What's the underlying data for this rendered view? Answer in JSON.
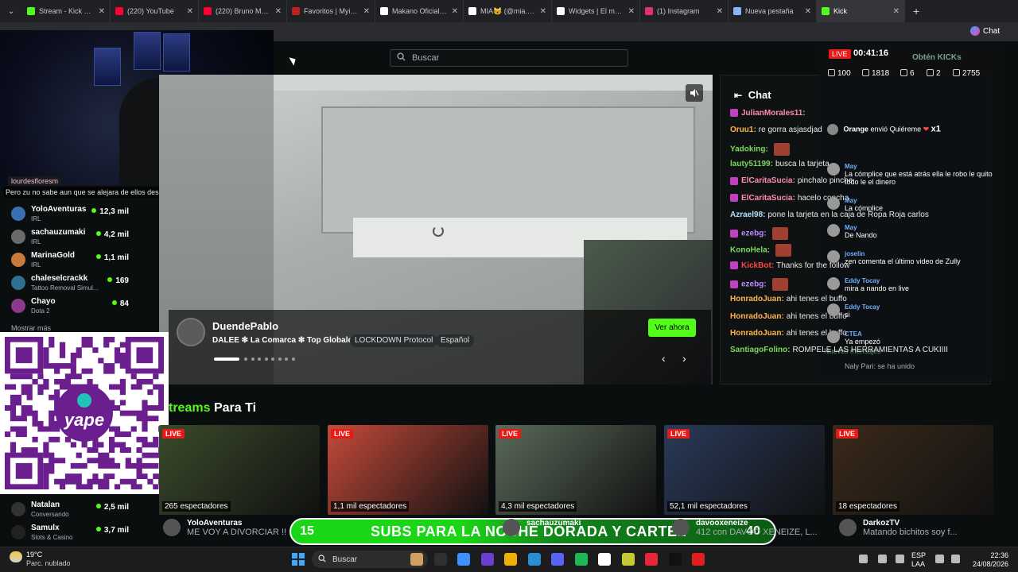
{
  "browser": {
    "tabs": [
      {
        "title": "Stream - Kick Dashb",
        "color": "#53fc18"
      },
      {
        "title": "(220) YouTube",
        "color": "#ff0033"
      },
      {
        "title": "(220) Bruno Mars - ",
        "color": "#ff0033"
      },
      {
        "title": "Favoritos | Myinstan",
        "color": "#c0201e"
      },
      {
        "title": "Makano Oficial (@m",
        "color": "#ffffff"
      },
      {
        "title": "MIA😺 (@mia.3s) | T",
        "color": "#ffffff"
      },
      {
        "title": "Widgets | El mejor s",
        "color": "#ffffff"
      },
      {
        "title": "(1) Instagram",
        "color": "#e1306c"
      },
      {
        "title": "Nueva pestaña",
        "color": "#8ab4f8"
      },
      {
        "title": "Kick",
        "color": "#53fc18"
      }
    ],
    "chat_button": "Chat"
  },
  "header": {
    "search_placeholder": "Buscar"
  },
  "webcam_overlay": {
    "username": "lourdesfloresm",
    "message": "Pero zu no sabe aun que se alejara de ellos después de esto"
  },
  "sidebar": {
    "channels": [
      {
        "name": "YoloAventuras",
        "category": "IRL",
        "viewers": "12,3 mil",
        "avatar_color": "#3a6fb0"
      },
      {
        "name": "sachauzumaki",
        "category": "IRL",
        "viewers": "4,2 mil",
        "avatar_color": "#6a6a6a"
      },
      {
        "name": "MarinaGold",
        "category": "IRL",
        "viewers": "1,1 mil",
        "avatar_color": "#c87a3a"
      },
      {
        "name": "chaleselcrackk",
        "category": "Tattoo Removal Simul...",
        "viewers": "169",
        "avatar_color": "#2f6f8f"
      },
      {
        "name": "Chayo",
        "category": "Dota 2",
        "viewers": "84",
        "avatar_color": "#8a3a8a"
      }
    ],
    "show_more": "Mostrar más",
    "bottom_channels": [
      {
        "name": "Natalan",
        "category": "Conversando",
        "viewers": "2,5 mil",
        "avatar_color": "#333333"
      },
      {
        "name": "Samulx",
        "category": "Slots & Casino",
        "viewers": "3,7 mil",
        "avatar_color": "#222222"
      }
    ]
  },
  "qr": {
    "brand": "yape",
    "accent": "#6b1f8f"
  },
  "featured": {
    "streamer": "DuendePablo",
    "title": "DALEE ❇ La Comarca ❇ Top Globales",
    "tags": [
      "LOCKDOWN Protocol",
      "Español"
    ],
    "watch_button": "Ver ahora",
    "slide_total": 9,
    "slide_active": 1
  },
  "chat": {
    "title": "Chat",
    "messages": [
      {
        "user": "JulianMorales11:",
        "text": "",
        "color": "#ff8ab0",
        "badge": true
      },
      {
        "user": "Oruu1:",
        "text": "re gorra asjasdjad",
        "color": "#ffb44a"
      },
      {
        "user": "Yadoking:",
        "text": "",
        "color": "#7bd858",
        "emote": true
      },
      {
        "user": "lauty51199:",
        "text": "busca la tarjeta",
        "color": "#7bd858"
      },
      {
        "user": "ElCaritaSucia:",
        "text": "pinchalo pinche",
        "color": "#ff8ab0",
        "badge": true
      },
      {
        "user": "ElCaritaSucia:",
        "text": "hacelo concha",
        "color": "#ff8ab0",
        "badge": true
      },
      {
        "user": "Azrael98:",
        "text": "pone la tarjeta en la caja de Ropa Roja carlos",
        "color": "#b0e0ff"
      },
      {
        "user": "ezebg:",
        "text": "",
        "color": "#b98bff",
        "badge": true,
        "emote": true
      },
      {
        "user": "KonoHela:",
        "text": "",
        "color": "#7bd858",
        "emote": true
      },
      {
        "user": "KickBot:",
        "text": "Thanks for the follow",
        "color": "#ff4444",
        "badge": true
      },
      {
        "user": "ezebg:",
        "text": "",
        "color": "#b98bff",
        "badge": true,
        "emote": true
      },
      {
        "user": "HonradoJuan:",
        "text": "ahi tenes el buffo",
        "color": "#ffb44a"
      },
      {
        "user": "HonradoJuan:",
        "text": "ahi tenes el buffo",
        "color": "#ffb44a"
      },
      {
        "user": "HonradoJuan:",
        "text": "ahi tenes el buffo",
        "color": "#ffb44a"
      },
      {
        "user": "SantiagoFolino:",
        "text": "ROMPELE LAS HERRAMIENTAS A CUKIIII",
        "color": "#7bd858"
      }
    ]
  },
  "obs": {
    "live_label": "LIVE",
    "timer": "00:41:16",
    "obtain_kicks": "Obtén KICKs",
    "stats": [
      "100",
      "1818",
      "6",
      "2",
      "2755"
    ],
    "gift_alert": {
      "user": "Orange",
      "text": "envió Quiéreme",
      "count": "x1"
    },
    "messages": [
      {
        "user": "May",
        "text": "La cómplice que está atrás ella le robo le quito todo le el dinero"
      },
      {
        "user": "May",
        "text": "La cómplice"
      },
      {
        "user": "May",
        "text": "De Nando"
      },
      {
        "user": "joselin",
        "text": "zen comenta el último video de Zully"
      },
      {
        "user": "Eddy Tocay",
        "text": "mira a nando en live"
      },
      {
        "user": "Eddy Tocay",
        "text": "si"
      },
      {
        "user": "CTEA",
        "text": "Ya empezó"
      }
    ],
    "new_messages": "Nuevos mensajes",
    "join_text": "Naly Pari: se ha unido"
  },
  "recommended": {
    "header_green": "treams",
    "header_white": "Para Ti",
    "live_label": "LIVE",
    "cards": [
      {
        "viewers": "265 espectadores",
        "bg": "#3a4a2a",
        "name": "YoloAventuras",
        "title": "ME VOY A DIVORCIAR !!"
      },
      {
        "viewers": "1,1 mil espectadores",
        "bg": "#c44a3a",
        "name": "",
        "title": ""
      },
      {
        "viewers": "4,3 mil espectadores",
        "bg": "#5a6a5a",
        "name": "sachauzumaki",
        "title": ""
      },
      {
        "viewers": "52,1 mil espectadores",
        "bg": "#2a3a5a",
        "name": "davooxeneize",
        "title": "412 con DAVOO XENEIZE, L..."
      },
      {
        "viewers": "18 espectadores",
        "bg": "#3a2a1a",
        "name": "DarkozTV",
        "title": "Matando bichitos soy f..."
      }
    ]
  },
  "subs_banner": {
    "count": "15",
    "text": "SUBS PARA LA NOCHE DORADA Y CARTEL",
    "right": "40"
  },
  "taskbar": {
    "weather_temp": "19°C",
    "weather_desc": "Parc. nublado",
    "search": "Buscar",
    "lang1": "ESP",
    "lang2": "LAA",
    "time": "22:36",
    "date": "24/08/2026"
  }
}
